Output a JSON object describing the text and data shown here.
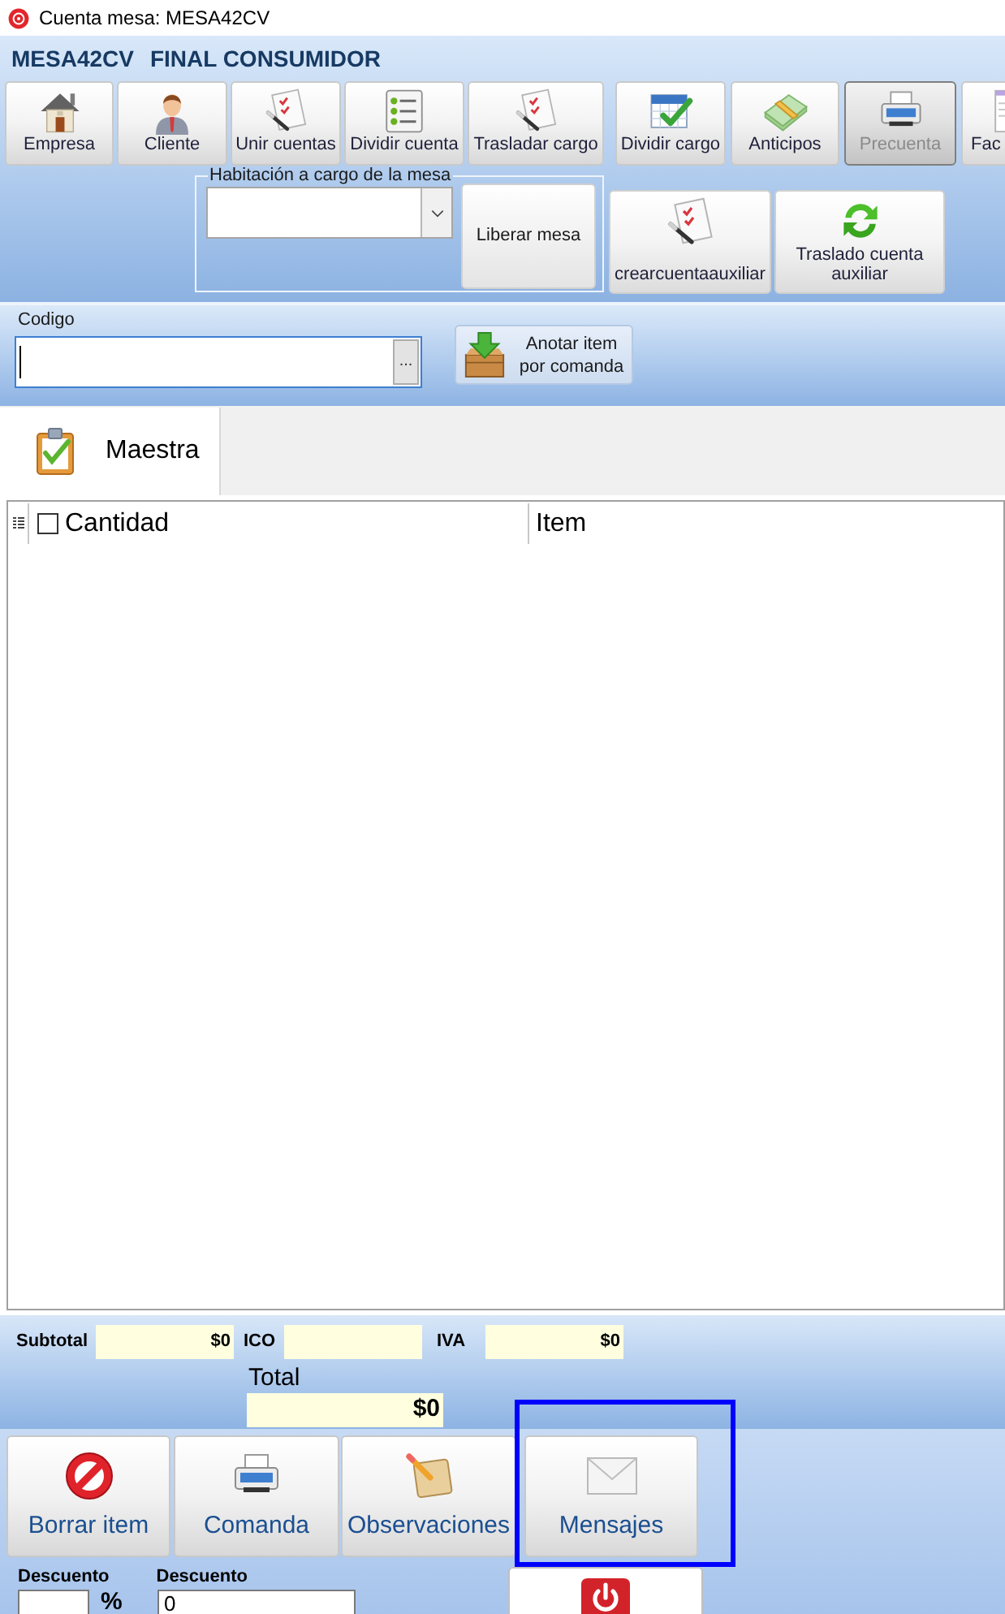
{
  "window": {
    "title": "Cuenta mesa: MESA42CV"
  },
  "header": {
    "table": "MESA42CV",
    "customer": "FINAL CONSUMIDOR"
  },
  "toolbar_groups": [
    {
      "buttons": [
        {
          "label": "Empresa",
          "disabled": false
        },
        {
          "label": "Cliente",
          "disabled": false
        },
        {
          "label": "Unir cuentas",
          "disabled": false
        },
        {
          "label": "Dividir cuenta",
          "disabled": false
        },
        {
          "label": "Trasladar cargo",
          "disabled": false
        }
      ]
    },
    {
      "buttons": [
        {
          "label": "Dividir cargo",
          "disabled": false
        },
        {
          "label": "Anticipos",
          "disabled": false
        },
        {
          "label": "Precuenta",
          "disabled": true
        },
        {
          "label": "Fac",
          "disabled": false
        }
      ]
    }
  ],
  "room_charge": {
    "label": "Habitación a cargo de la mesa",
    "release_button": "Liberar mesa"
  },
  "aux_buttons": [
    {
      "label": "crearcuentaauxiliar"
    },
    {
      "label": "Traslado cuenta auxiliar"
    }
  ],
  "code": {
    "label": "Codigo",
    "focused": true,
    "browse_button": "...",
    "add_button": "Anotar item por comanda"
  },
  "tabs": [
    {
      "label": "Maestra",
      "selected": true
    }
  ],
  "grid": {
    "columns": [
      {
        "label": "Cantidad",
        "checked": false
      },
      {
        "label": "Item"
      }
    ]
  },
  "totals": [
    {
      "label": "Subtotal",
      "value": "$0"
    },
    {
      "label": "ICO"
    },
    {
      "label": "IVA",
      "value": "$0"
    }
  ],
  "total": {
    "label": "Total",
    "value": "$0"
  },
  "actions": [
    {
      "label": "Borrar item",
      "highlighted": false
    },
    {
      "label": "Comanda",
      "highlighted": false
    },
    {
      "label": "Observaciones",
      "highlighted": false
    },
    {
      "label": "Mensajes",
      "highlighted": true
    }
  ],
  "discount": [
    {
      "label": "Descuento",
      "unit": "%"
    },
    {
      "label": "Descuento",
      "value": "0"
    }
  ]
}
